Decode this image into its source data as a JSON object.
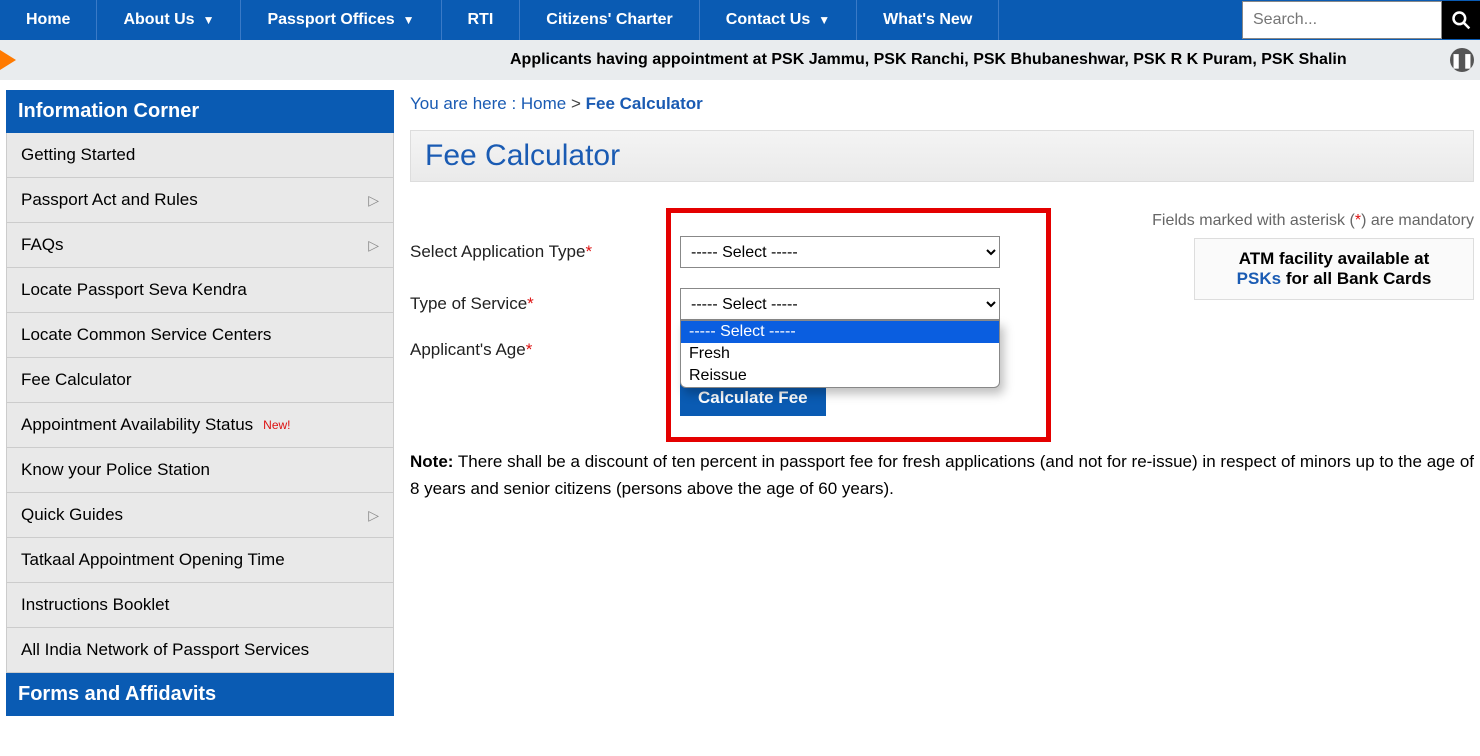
{
  "nav": {
    "items": [
      {
        "label": "Home",
        "dropdown": false
      },
      {
        "label": "About Us",
        "dropdown": true
      },
      {
        "label": "Passport Offices",
        "dropdown": true
      },
      {
        "label": "RTI",
        "dropdown": false
      },
      {
        "label": "Citizens' Charter",
        "dropdown": false
      },
      {
        "label": "Contact Us",
        "dropdown": true
      },
      {
        "label": "What's New",
        "dropdown": false
      }
    ],
    "search_placeholder": "Search..."
  },
  "marquee": "Applicants having appointment at PSK Jammu, PSK Ranchi, PSK Bhubaneshwar, PSK R K Puram, PSK Shalin",
  "sidebar": {
    "sections": [
      {
        "head": "Information Corner",
        "items": [
          {
            "label": "Getting Started",
            "arrow": false
          },
          {
            "label": "Passport Act and Rules",
            "arrow": true
          },
          {
            "label": "FAQs",
            "arrow": true
          },
          {
            "label": "Locate Passport Seva Kendra",
            "arrow": false
          },
          {
            "label": "Locate Common Service Centers",
            "arrow": false
          },
          {
            "label": "Fee Calculator",
            "arrow": false
          },
          {
            "label": "Appointment Availability Status",
            "arrow": false,
            "new": "New!"
          },
          {
            "label": "Know your Police Station",
            "arrow": false
          },
          {
            "label": "Quick Guides",
            "arrow": true
          },
          {
            "label": "Tatkaal Appointment Opening Time",
            "arrow": false
          },
          {
            "label": "Instructions Booklet",
            "arrow": false
          },
          {
            "label": "All India Network of Passport Services",
            "arrow": false
          }
        ]
      },
      {
        "head": "Forms and Affidavits",
        "items": []
      }
    ]
  },
  "breadcrumb": {
    "prefix": "You are here : ",
    "home": "Home",
    "sep": " > ",
    "current": "Fee Calculator"
  },
  "page_title": "Fee Calculator",
  "fields_note": {
    "pre": "Fields marked with asterisk (",
    "ast": "*",
    "post": ") are mandatory"
  },
  "atm": {
    "line1": "ATM facility available at ",
    "link": "PSKs",
    "line2": "  for all Bank Cards"
  },
  "form": {
    "app_type_label": "Select Application Type",
    "svc_label": "Type of Service",
    "age_label": "Applicant's Age",
    "select_placeholder": "----- Select -----",
    "svc_options": [
      "----- Select -----",
      "Fresh",
      "Reissue"
    ],
    "calc_btn": "Calculate Fee"
  },
  "note": {
    "label": "Note:",
    "text": " There shall be a discount of ten percent in passport fee for fresh applications (and not for re-issue) in respect of minors up to the age of 8 years and senior citizens (persons above the age of 60 years)."
  }
}
